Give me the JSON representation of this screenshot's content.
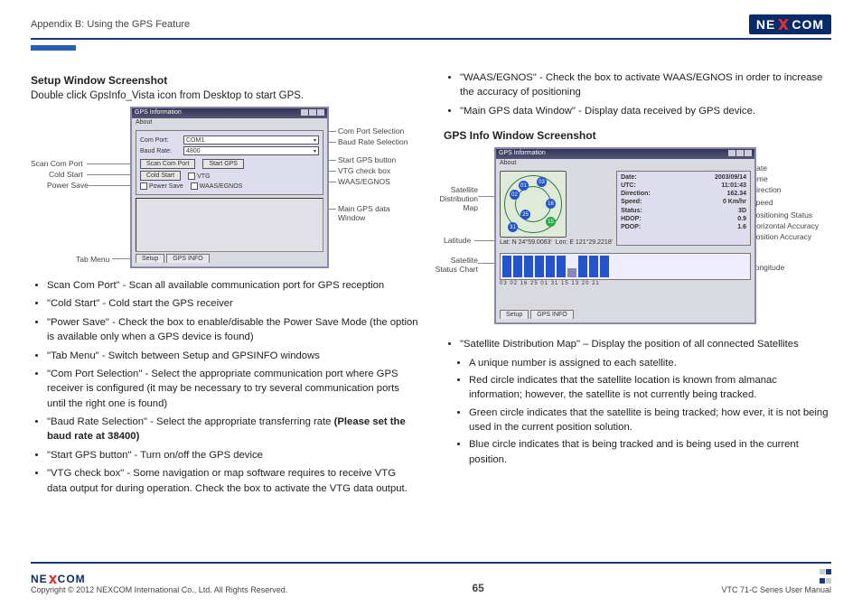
{
  "header": {
    "appendix": "Appendix B: Using the GPS Feature",
    "brand": "NE COM"
  },
  "left": {
    "h1": "Setup Window Screenshot",
    "lead": "Double click GpsInfo_Vista icon from Desktop to start GPS.",
    "setup": {
      "title": "GPS Information",
      "about": "About",
      "comport_lbl": "Com Port:",
      "comport_val": "COM1",
      "baud_lbl": "Baud Rate:",
      "baud_val": "4800",
      "scan_btn": "Scan Com Port",
      "start_btn": "Start GPS",
      "cold_btn": "Cold Start",
      "vtg_lbl": "VTG",
      "power_lbl": "Power Save",
      "waas_lbl": "WAAS/EGNOS",
      "tab_setup": "Setup",
      "tab_info": "GPS INFO"
    },
    "callouts": {
      "scan": "Scan Com Port",
      "cold": "Cold Start",
      "power": "Power Save",
      "tab": "Tab Menu",
      "comsel": "Com Port Selection",
      "baudsel": "Baud Rate Selection",
      "startbtn": "Start GPS button",
      "vtg": "VTG check box",
      "waas": "WAAS/EGNOS",
      "mainwin": "Main GPS data Window"
    },
    "bullets": [
      "Scan Com Port\" - Scan all available communication port for GPS reception",
      "\"Cold Start\" - Cold start the GPS receiver",
      "\"Power Save\" - Check the box to enable/disable the Power Save Mode (the option is available only when a GPS device is found)",
      "\"Tab Menu\" - Switch between Setup and GPSINFO windows",
      "\"Com Port Selection\" - Select the appropriate communication port where GPS receiver is configured (it may be necessary to try several communication ports until the right one is found)",
      "\"Baud Rate Selection\" - Select the appropriate transferring rate ",
      "\"Start GPS button\" - Turn on/off the GPS device",
      "\"VTG check box\" - Some navigation or map software requires to receive VTG data output for during operation. Check the box to activate the VTG data output."
    ],
    "baud_bold": "(Please set the baud rate at 38400)"
  },
  "right": {
    "top_bullets": [
      "\"WAAS/EGNOS\" - Check the box to activate WAAS/EGNOS in order to increase the accuracy of positioning",
      "\"Main GPS data Window\" - Display data received by GPS device."
    ],
    "h2": "GPS Info Window Screenshot",
    "info": {
      "title": "GPS Information",
      "about": "About",
      "date_lbl": "Date:",
      "date_val": "2003/09/14",
      "utc_lbl": "UTC:",
      "utc_val": "11:01:43",
      "dir_lbl": "Direction:",
      "dir_val": "162.34",
      "speed_lbl": "Speed:",
      "speed_val": "0 Km/hr",
      "status_lbl": "Status:",
      "status_val": "3D",
      "hdop_lbl": "HDOP:",
      "hdop_val": "0.9",
      "pdop_lbl": "PDOP:",
      "pdop_val": "1.6",
      "lat": "Lat: N  24°59.0063'",
      "lon": "Lon: E  121°29.2218'",
      "barlabels": "03 02 16 25 01 31 15 13 20 21",
      "tab_setup": "Setup",
      "tab_info": "GPS INFO"
    },
    "callouts": {
      "satmap": "Satellite Distribution Map",
      "lat": "Latitude",
      "satchart": "Satellite Status Chart",
      "date": "Date",
      "time": "Time",
      "dir": "Direction",
      "speed": "Speed",
      "pos": "Positioning Status",
      "hacc": "Horizontal Accuracy",
      "pacc": "Position Accuracy",
      "lon": "Longitude"
    },
    "bullets": [
      "\"Satellite Distribution Map\" – Display the position of all connected Satellites"
    ],
    "sub": [
      "A unique number is assigned to each satellite.",
      "Red circle indicates that the satellite location is known from almanac information; however, the satellite is not currently being tracked.",
      "Green circle indicates that the satellite is being tracked; how ever, it is not being used in the current position solution.",
      "Blue circle indicates that is being tracked and is being used in the current position."
    ]
  },
  "footer": {
    "brand": "NE COM",
    "copyright": "Copyright © 2012 NEXCOM International Co., Ltd. All Rights Reserved.",
    "page": "65",
    "manual": "VTC 71-C Series User Manual"
  }
}
